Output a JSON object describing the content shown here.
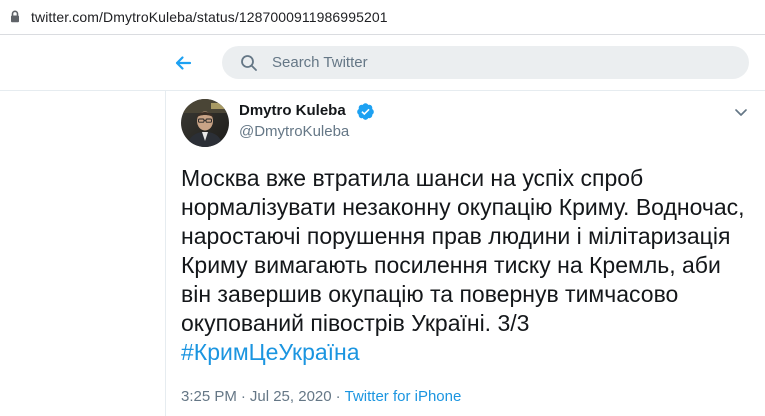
{
  "browser": {
    "url": "twitter.com/DmytroKuleba/status/1287000911986995201"
  },
  "header": {
    "search_placeholder": "Search Twitter"
  },
  "tweet": {
    "author_name": "Dmytro Kuleba",
    "author_handle": "@DmytroKuleba",
    "text_lines": [
      "Москва вже втратила шанси на успіх спроб",
      "нормалізувати незаконну окупацію Криму. Водночас,",
      "наростаючі порушення прав людини і мілітаризація",
      "Криму вимагають посилення тиску на Кремль, аби",
      "він завершив окупацію та повернув тимчасово",
      "окупований півострів Україні. 3/3"
    ],
    "hashtag": "#КримЦеУкраїна",
    "time": "3:25 PM",
    "date": "Jul 25, 2020",
    "separator": "·",
    "source": "Twitter for iPhone"
  },
  "colors": {
    "brand_blue": "#1da1f2",
    "link_blue": "#1b95e0",
    "text_primary": "#14171a",
    "text_secondary": "#657786",
    "search_bg": "#ebeef0"
  },
  "icons": {
    "lock": "lock-icon",
    "back": "arrow-left-icon",
    "search": "search-icon",
    "verified": "verified-badge-icon",
    "caret": "chevron-down-icon"
  }
}
